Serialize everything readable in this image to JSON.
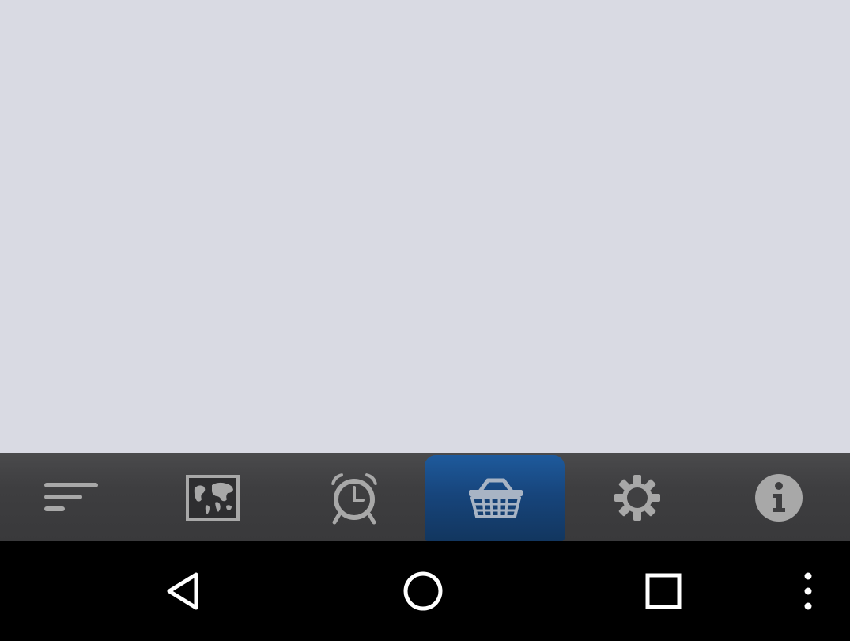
{
  "colors": {
    "content_background": "#d9dae3",
    "tab_bar_background": "#3e3e40",
    "active_tab": "#17457c",
    "icon_gray": "#a8a8a8",
    "nav_bar_background": "#000000",
    "nav_icon": "#ffffff"
  },
  "tab_bar": {
    "active_tab": "basket",
    "tabs": [
      {
        "id": "list",
        "icon": "sort-lines-icon"
      },
      {
        "id": "map",
        "icon": "world-map-icon"
      },
      {
        "id": "alarm",
        "icon": "alarm-clock-icon"
      },
      {
        "id": "basket",
        "icon": "shopping-basket-icon"
      },
      {
        "id": "settings",
        "icon": "gear-icon"
      },
      {
        "id": "info",
        "icon": "info-icon"
      }
    ]
  },
  "nav_bar": {
    "buttons": [
      {
        "id": "back",
        "icon": "back-triangle-icon"
      },
      {
        "id": "home",
        "icon": "home-circle-icon"
      },
      {
        "id": "recents",
        "icon": "recents-square-icon"
      },
      {
        "id": "menu",
        "icon": "overflow-dots-icon"
      }
    ]
  }
}
